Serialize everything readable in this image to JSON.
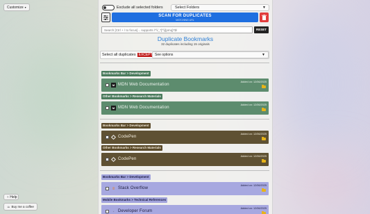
{
  "floating": {
    "customize_label": "Customize",
    "help_label": "Help",
    "coffee_label": "Buy me a coffee"
  },
  "toolbar": {
    "exclude_label": "Exclude all selected folders",
    "select_folders": "Select Folders",
    "scan_label": "SCAN FOR DUPLICATES",
    "scan_sublabel": "MATCHING URL",
    "search_placeholder": "Search [Ctrl + / to focus]... supports /^\\/_*[^\\]{pmq}*$/",
    "reset_label": "RESET"
  },
  "summary": {
    "title": "Duplicate Bookmarks",
    "subtitle": "32 duplicates including 15 originals",
    "select_all_label": "Select all duplicates",
    "except_label": "EXCEPT",
    "see_options": "See options"
  },
  "groups": [
    {
      "theme": "green",
      "items": [
        {
          "path": "Bookmarks Bar > Development",
          "name": "MDN Web Documentation",
          "added": "Added on: 12/06/2025",
          "icon": "mdn-icon"
        },
        {
          "path": "Other Bookmarks > Research Materials",
          "name": "MDN Web Documentation",
          "added": "Added on: 12/06/2025",
          "icon": "mdn-icon"
        }
      ]
    },
    {
      "theme": "brown",
      "items": [
        {
          "path": "Bookmarks Bar > Development",
          "name": "CodePen",
          "added": "Added on: 12/06/2025",
          "icon": "codepen-icon"
        },
        {
          "path": "Other Bookmarks > Research Materials",
          "name": "CodePen",
          "added": "Added on: 12/06/2025",
          "icon": "codepen-icon"
        }
      ]
    },
    {
      "theme": "violet",
      "items": [
        {
          "path": "Bookmarks Bar > Development",
          "name": "Stack Overflow",
          "added": "Added on: 12/06/2025",
          "icon": "stackoverflow-icon"
        },
        {
          "path": "Mobile Bookmarks > Technical References",
          "name": "Developer Forum",
          "added": "Added on: 12/06/2025",
          "icon": "forum-icon"
        }
      ]
    }
  ]
}
